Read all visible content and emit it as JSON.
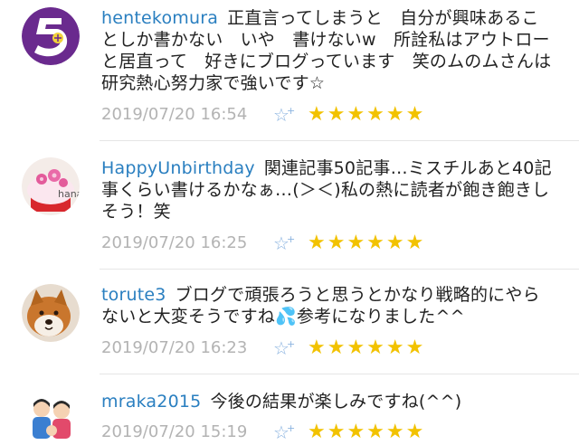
{
  "comments": [
    {
      "username": "hentekomura",
      "text": "正直言ってしまうと　自分が興味あることしか書かない　いや　書けないw　所詮私はアウトローと居直って　好きにブログっています　笑のムのムさんは研究熱心努力家で強いです☆",
      "timestamp": "2019/07/20 16:54",
      "stars": "★★★★★★",
      "add_star_icon": "add-star-icon",
      "avatar": "purple-logo-avatar"
    },
    {
      "username": "HappyUnbirthday",
      "text": "関連記事50記事…ミスチルあと40記事くらい書けるかなぁ…(＞＜)私の熱に読者が飽き飽きしそう！笑",
      "timestamp": "2019/07/20 16:25",
      "stars": "★★★★★★",
      "add_star_icon": "add-star-icon",
      "avatar": "cupcake-avatar",
      "avatar_text": "hana"
    },
    {
      "username": "torute3",
      "text": "ブログで頑張ろうと思うとかなり戦略的にやらないと大変そうですね💦参考になりました^^",
      "timestamp": "2019/07/20 16:23",
      "stars": "★★★★★★",
      "add_star_icon": "add-star-icon",
      "avatar": "shiba-dog-avatar"
    },
    {
      "username": "mraka2015",
      "text": "今後の結果が楽しみですね(^^)",
      "timestamp": "2019/07/20 15:19",
      "stars": "★★★★★★",
      "add_star_icon": "add-star-icon",
      "avatar": "family-illustration-avatar"
    }
  ],
  "colors": {
    "username": "#2a7fc0",
    "text": "#222222",
    "timestamp": "#b3b3b3",
    "star": "#f2c200",
    "add_star": "#8cb4e0"
  }
}
